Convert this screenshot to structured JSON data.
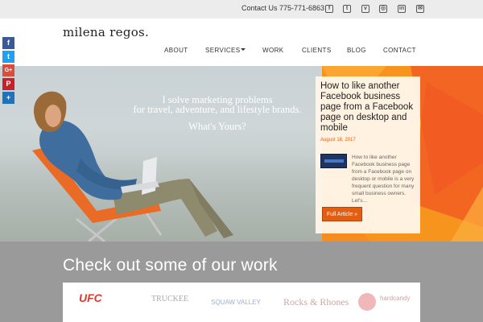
{
  "topbar": {
    "contact": "Contact Us 775-771-6863",
    "social_icons": [
      "facebook-icon",
      "twitter-icon",
      "vimeo-icon",
      "instagram-icon",
      "linkedin-icon",
      "email-icon"
    ]
  },
  "header": {
    "logo": "milena regos.",
    "nav": [
      "ABOUT",
      "SERVICES",
      "WORK",
      "CLIENTS",
      "BLOG",
      "CONTACT"
    ]
  },
  "hero": {
    "line1": "I solve marketing problems",
    "line2": "for travel, adventure, and lifestyle brands.",
    "line3": "What's Yours?",
    "accent_color": "#f7941d"
  },
  "post": {
    "title": "How to like another Facebook business page from a Facebook page on desktop and mobile",
    "date": "August 18, 2017",
    "excerpt": "How to like another Facebook business page from a Facebook page on desktop or mobile is a very frequent question for many small business owners. Let's…",
    "button": "Full Article »"
  },
  "share": [
    {
      "icon": "facebook-icon",
      "label": "f",
      "color": "#3b5998"
    },
    {
      "icon": "twitter-icon",
      "label": "t",
      "color": "#1da1f2"
    },
    {
      "icon": "google-plus-icon",
      "label": "G+",
      "color": "#dd4b39"
    },
    {
      "icon": "pinterest-icon",
      "label": "P",
      "color": "#cb2027"
    },
    {
      "icon": "share-icon",
      "label": "+",
      "color": "#1e73be"
    }
  ],
  "work": {
    "title": "Check out some of our work",
    "clients": [
      "UFC",
      "TRUCKEE",
      "SQUAW VALLEY",
      "Rocks & Rhones",
      "hardcandy"
    ]
  }
}
